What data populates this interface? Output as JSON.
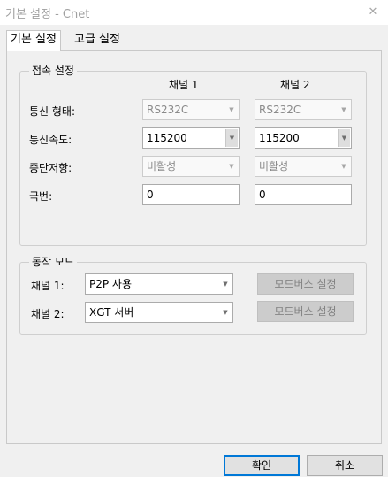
{
  "window": {
    "title": "기본 설정 - Cnet",
    "close_glyph": "✕"
  },
  "tabs": [
    {
      "label": "기본 설정",
      "active": true
    },
    {
      "label": "고급 설정",
      "active": false
    }
  ],
  "connection": {
    "legend": "접속 설정",
    "channel_headers": [
      "채널 1",
      "채널 2"
    ],
    "rows": [
      {
        "label": "통신 형태:",
        "values": [
          "RS232C",
          "RS232C"
        ]
      },
      {
        "label": "통신속도:",
        "values": [
          "115200",
          "115200"
        ]
      },
      {
        "label": "종단저항:",
        "values": [
          "비활성",
          "비활성"
        ]
      },
      {
        "label": "국번:",
        "values": [
          "0",
          "0"
        ]
      }
    ]
  },
  "mode": {
    "legend": "동작 모드",
    "rows": [
      {
        "label": "채널 1:",
        "value": "P2P 사용",
        "button": "모드버스 설정"
      },
      {
        "label": "채널 2:",
        "value": "XGT 서버",
        "button": "모드버스 설정"
      }
    ]
  },
  "footer": {
    "ok": "확인",
    "cancel": "취소"
  },
  "colors": {
    "accent": "#0078d7",
    "disabled_text": "#8a8a8a",
    "background": "#f0f0f0"
  }
}
